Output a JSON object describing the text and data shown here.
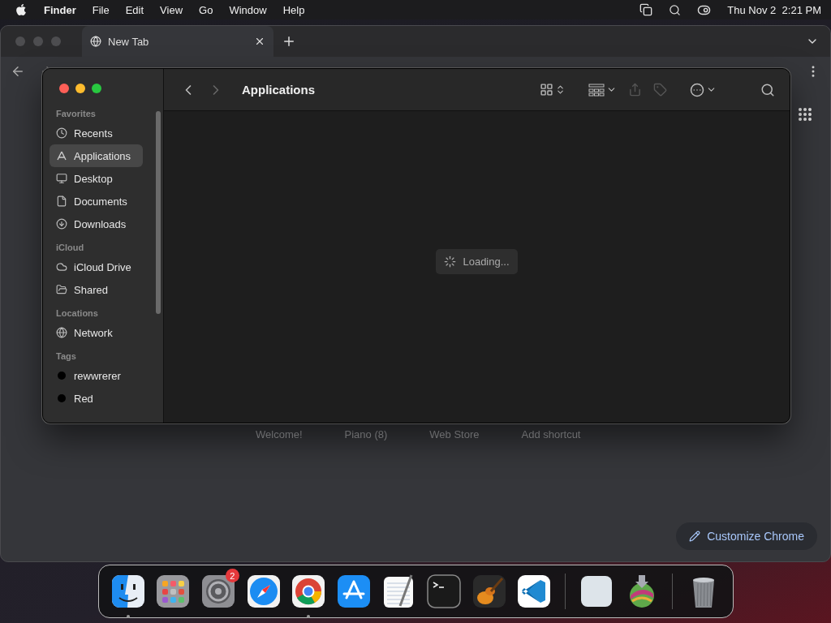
{
  "menu_bar": {
    "app_name": "Finder",
    "menus": [
      "File",
      "Edit",
      "View",
      "Go",
      "Window",
      "Help"
    ],
    "date": "Thu Nov 2",
    "time": "2:21 PM"
  },
  "browser": {
    "tab": {
      "title": "New Tab",
      "selected": true
    },
    "shortcuts": [
      "Welcome!",
      "Piano (8)",
      "Web Store",
      "Add shortcut"
    ],
    "customize_button": "Customize Chrome"
  },
  "finder": {
    "title": "Applications",
    "loading_text": "Loading...",
    "sidebar": [
      {
        "heading": "Favorites",
        "items": [
          {
            "label": "Recents",
            "kind": "recents",
            "selected": false
          },
          {
            "label": "Applications",
            "kind": "applications",
            "selected": true
          },
          {
            "label": "Desktop",
            "kind": "desktop",
            "selected": false
          },
          {
            "label": "Documents",
            "kind": "documents",
            "selected": false
          },
          {
            "label": "Downloads",
            "kind": "downloads",
            "selected": false
          }
        ]
      },
      {
        "heading": "iCloud",
        "items": [
          {
            "label": "iCloud Drive",
            "kind": "cloud",
            "selected": false
          },
          {
            "label": "Shared",
            "kind": "shared",
            "selected": false
          }
        ]
      },
      {
        "heading": "Locations",
        "items": [
          {
            "label": "Network",
            "kind": "network",
            "selected": false
          }
        ]
      },
      {
        "heading": "Tags",
        "items": [
          {
            "label": "rewwrerer",
            "kind": "tag",
            "color": "#000000",
            "selected": false
          },
          {
            "label": "Red",
            "kind": "tag",
            "color": "#000000",
            "selected": false
          }
        ]
      }
    ]
  },
  "dock": {
    "items": [
      {
        "kind": "finder",
        "running": true
      },
      {
        "kind": "launchpad",
        "running": false
      },
      {
        "kind": "settings",
        "running": false,
        "badge": "2"
      },
      {
        "kind": "safari",
        "running": false
      },
      {
        "kind": "chrome",
        "running": true
      },
      {
        "kind": "appstore",
        "running": false
      },
      {
        "kind": "textedit",
        "running": false
      },
      {
        "kind": "terminal",
        "running": false
      },
      {
        "kind": "garageband",
        "running": false
      },
      {
        "kind": "vscode",
        "running": false
      },
      {
        "kind": "separator"
      },
      {
        "kind": "blank",
        "running": false
      },
      {
        "kind": "installer",
        "running": false
      },
      {
        "kind": "separator"
      },
      {
        "kind": "trash",
        "running": false
      }
    ]
  }
}
